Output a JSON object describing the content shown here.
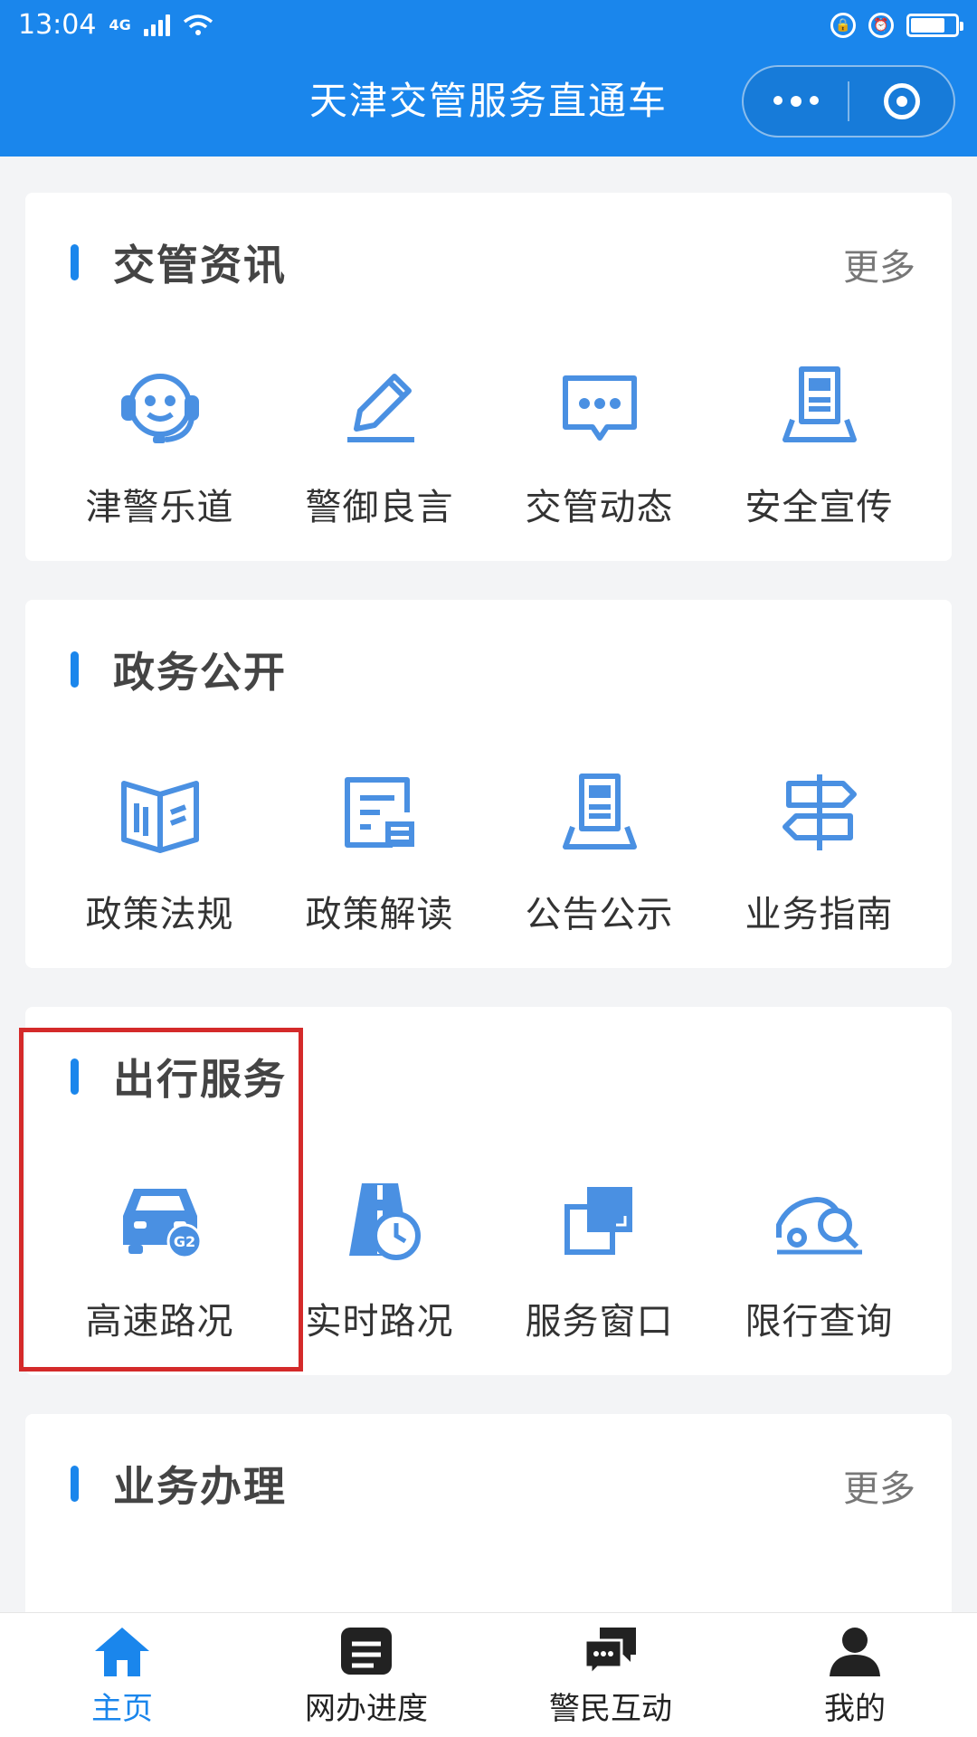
{
  "status": {
    "time": "13:04",
    "network": "4G"
  },
  "header": {
    "title": "天津交管服务直通车"
  },
  "sections": [
    {
      "title": "交管资讯",
      "more": "更多",
      "items": [
        {
          "label": "津警乐道",
          "icon": "headset-smile-icon"
        },
        {
          "label": "警御良言",
          "icon": "pen-icon"
        },
        {
          "label": "交管动态",
          "icon": "chat-bubble-icon"
        },
        {
          "label": "安全宣传",
          "icon": "document-tray-icon"
        }
      ]
    },
    {
      "title": "政务公开",
      "items": [
        {
          "label": "政策法规",
          "icon": "open-book-icon"
        },
        {
          "label": "政策解读",
          "icon": "document-edit-icon"
        },
        {
          "label": "公告公示",
          "icon": "document-tray-icon"
        },
        {
          "label": "业务指南",
          "icon": "signpost-icon"
        }
      ]
    },
    {
      "title": "出行服务",
      "items": [
        {
          "label": "高速路况",
          "icon": "car-g2-icon",
          "badge": "G2"
        },
        {
          "label": "实时路况",
          "icon": "road-clock-icon"
        },
        {
          "label": "服务窗口",
          "icon": "window-squares-icon"
        },
        {
          "label": "限行查询",
          "icon": "car-search-icon"
        }
      ]
    },
    {
      "title": "业务办理",
      "more": "更多"
    }
  ],
  "tabbar": [
    {
      "label": "主页",
      "icon": "home-icon",
      "active": true
    },
    {
      "label": "网办进度",
      "icon": "list-box-icon"
    },
    {
      "label": "警民互动",
      "icon": "chat-icon"
    },
    {
      "label": "我的",
      "icon": "user-icon"
    }
  ],
  "colors": {
    "primary": "#1a86ec",
    "highlight": "#d42a2a",
    "icon": "#4a90e2"
  }
}
